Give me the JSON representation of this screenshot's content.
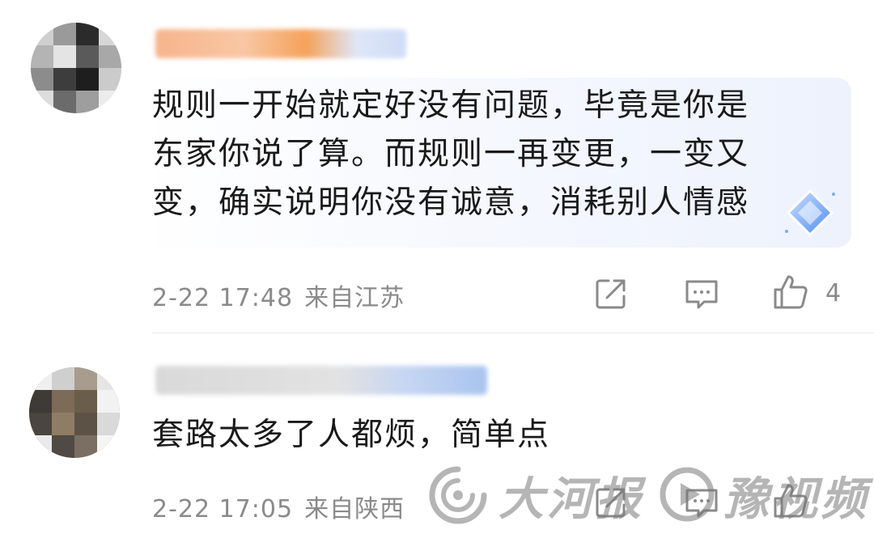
{
  "comments": [
    {
      "text": "规则一开始就定好没有问题，毕竟是你是\n东家你说了算。而规则一再变更，一变又\n变，确实说明你没有诚意，消耗别人情感",
      "date": "2-22 17:48",
      "location": "来自江苏",
      "likes": "4",
      "icons": [
        "share-icon",
        "reply-icon",
        "like-icon"
      ]
    },
    {
      "text": "套路太多了人都烦，简单点",
      "date": "2-22 17:05",
      "location": "来自陕西",
      "likes": "",
      "icons": [
        "share-icon",
        "reply-icon",
        "like-icon"
      ]
    }
  ],
  "watermark": {
    "left_text": "大河报",
    "right_text": "豫视频"
  },
  "colors": {
    "text": "#1a1a1a",
    "meta": "#8a8a8a",
    "bubble": "#edf2fd",
    "divider": "#ececec"
  }
}
